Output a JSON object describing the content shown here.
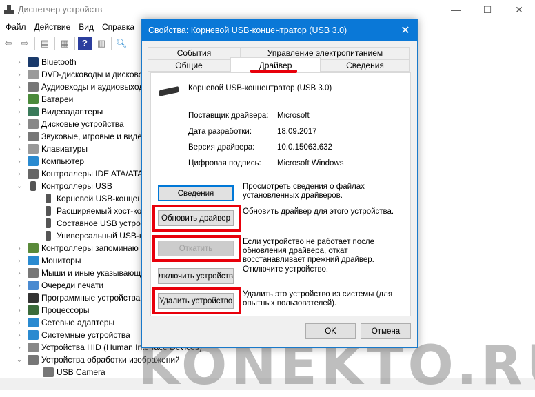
{
  "window": {
    "title": "Диспетчер устройств"
  },
  "menu": [
    "Файл",
    "Действие",
    "Вид",
    "Справка"
  ],
  "tree": [
    {
      "label": "Bluetooth",
      "expanded": false,
      "level": 0,
      "icon": "bluetooth-icon",
      "color": "#1a3a6b"
    },
    {
      "label": "DVD-дисководы и дисково",
      "expanded": false,
      "level": 0,
      "icon": "dvd-icon",
      "color": "#9a9a9a"
    },
    {
      "label": "Аудиовходы и аудиовыход",
      "expanded": false,
      "level": 0,
      "icon": "audio-icon",
      "color": "#777777"
    },
    {
      "label": "Батареи",
      "expanded": false,
      "level": 0,
      "icon": "battery-icon",
      "color": "#4a8a3a"
    },
    {
      "label": "Видеоадаптеры",
      "expanded": false,
      "level": 0,
      "icon": "display-adapter-icon",
      "color": "#3a7a5a"
    },
    {
      "label": "Дисковые устройства",
      "expanded": false,
      "level": 0,
      "icon": "disk-icon",
      "color": "#888888"
    },
    {
      "label": "Звуковые, игровые и виде",
      "expanded": false,
      "level": 0,
      "icon": "sound-icon",
      "color": "#777777"
    },
    {
      "label": "Клавиатуры",
      "expanded": false,
      "level": 0,
      "icon": "keyboard-icon",
      "color": "#999999"
    },
    {
      "label": "Компьютер",
      "expanded": false,
      "level": 0,
      "icon": "computer-icon",
      "color": "#2a8ad0"
    },
    {
      "label": "Контроллеры IDE ATA/ATA",
      "expanded": false,
      "level": 0,
      "icon": "ide-icon",
      "color": "#666666"
    },
    {
      "label": "Контроллеры USB",
      "expanded": true,
      "level": 0,
      "icon": "usb-icon",
      "color": "#555555"
    },
    {
      "label": "Корневой USB-концент",
      "level": 1,
      "icon": "usb-icon",
      "color": "#555555"
    },
    {
      "label": "Расширяемый хост-ко",
      "level": 1,
      "icon": "usb-icon",
      "color": "#555555"
    },
    {
      "label": "Составное USB устрой",
      "level": 1,
      "icon": "usb-icon",
      "color": "#555555"
    },
    {
      "label": "Универсальный USB-к",
      "level": 1,
      "icon": "usb-icon",
      "color": "#555555"
    },
    {
      "label": "Контроллеры запоминаю",
      "expanded": false,
      "level": 0,
      "icon": "storage-icon",
      "color": "#5a8a3a"
    },
    {
      "label": "Мониторы",
      "expanded": false,
      "level": 0,
      "icon": "monitor-icon",
      "color": "#2a8ad0"
    },
    {
      "label": "Мыши и иные указывающ",
      "expanded": false,
      "level": 0,
      "icon": "mouse-icon",
      "color": "#777777"
    },
    {
      "label": "Очереди печати",
      "expanded": false,
      "level": 0,
      "icon": "printer-icon",
      "color": "#4a8ad0"
    },
    {
      "label": "Программные устройства",
      "expanded": false,
      "level": 0,
      "icon": "software-device-icon",
      "color": "#333333"
    },
    {
      "label": "Процессоры",
      "expanded": false,
      "level": 0,
      "icon": "cpu-icon",
      "color": "#3a6a3a"
    },
    {
      "label": "Сетевые адаптеры",
      "expanded": false,
      "level": 0,
      "icon": "network-icon",
      "color": "#2a8ad0"
    },
    {
      "label": "Системные устройства",
      "expanded": false,
      "level": 0,
      "icon": "system-icon",
      "color": "#2a8ad0"
    },
    {
      "label": "Устройства HID (Human Interface Devices)",
      "expanded": false,
      "level": 0,
      "icon": "hid-icon",
      "color": "#888888"
    },
    {
      "label": "Устройства обработки изображений",
      "expanded": true,
      "level": 0,
      "icon": "camera-icon",
      "color": "#777777"
    },
    {
      "label": "USB Camera",
      "level": 1,
      "icon": "camera-icon",
      "color": "#777777"
    }
  ],
  "dialog": {
    "title": "Свойства: Корневой USB-концентратор (USB 3.0)",
    "tabs_top": [
      "События",
      "Управление электропитанием"
    ],
    "tabs_bottom": [
      "Общие",
      "Драйвер",
      "Сведения"
    ],
    "active_tab": "Драйвер",
    "device_name": "Корневой USB-концентратор (USB 3.0)",
    "props": [
      {
        "label": "Поставщик драйвера:",
        "value": "Microsoft"
      },
      {
        "label": "Дата разработки:",
        "value": "18.09.2017"
      },
      {
        "label": "Версия драйвера:",
        "value": "10.0.15063.632"
      },
      {
        "label": "Цифровая подпись:",
        "value": "Microsoft Windows"
      }
    ],
    "actions": [
      {
        "button": "Сведения",
        "desc": "Просмотреть сведения о файлах установленных драйверов.",
        "state": "default",
        "highlighted": false
      },
      {
        "button": "Обновить драйвер",
        "desc": "Обновить драйвер для этого устройства.",
        "state": "normal",
        "highlighted": true
      },
      {
        "button": "Откатить",
        "desc": "Если устройство не работает после обновления драйвера, откат восстанавливает прежний драйвер.",
        "state": "disabled",
        "highlighted": true
      },
      {
        "button": "Отключить устройство",
        "desc": "Отключите устройство.",
        "state": "normal",
        "highlighted": false
      },
      {
        "button": "Удалить устройство",
        "desc": "Удалить это устройство из системы (для опытных пользователей).",
        "state": "normal",
        "highlighted": true
      }
    ],
    "ok": "OK",
    "cancel": "Отмена"
  },
  "watermark": "KONEKTO.RU",
  "colors": {
    "accent": "#0a78d7",
    "highlight": "#e8000b"
  }
}
